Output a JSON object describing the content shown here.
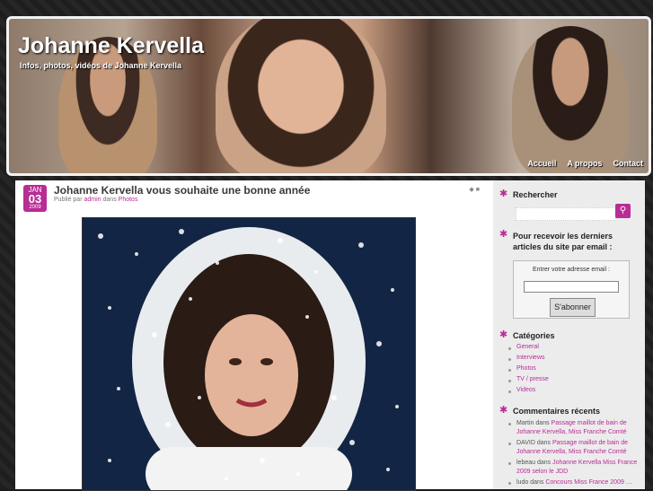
{
  "site": {
    "title": "Johanne Kervella",
    "tagline": "Infos, photos, vidéos de Johanne Kervella",
    "nav": [
      "Accueil",
      "A propos",
      "Contact"
    ]
  },
  "post": {
    "date": {
      "month": "JAN",
      "day": "03",
      "year": "2009"
    },
    "title": "Johanne Kervella vous souhaite une bonne année",
    "meta_prefix": "Publié par",
    "author": "admin",
    "meta_mid": "dans",
    "category": "Photos"
  },
  "sidebar": {
    "search_title": "Rechercher",
    "subscribe_title": "Pour recevoir les derniers articles du site par email :",
    "subscribe_label": "Entrer votre adresse email :",
    "subscribe_button": "S'abonner",
    "categories_title": "Catégories",
    "categories": [
      "General",
      "Interviews",
      "Photos",
      "TV / presse",
      "Videos"
    ],
    "comments_title": "Commentaires récents",
    "comments": [
      {
        "who": "Martin",
        "sep": "dans",
        "link": "Passage maillot de bain de Johanne Kervella, Miss Franche Comté"
      },
      {
        "who": "DAVID",
        "sep": "dans",
        "link": "Passage maillot de bain de Johanne Kervella, Miss Franche Comté"
      },
      {
        "who": "lebeau",
        "sep": "dans",
        "link": "Johanne Kervella Miss France 2009 selon le JDD"
      },
      {
        "who": "ludo",
        "sep": "dans",
        "link": "Concours Miss France 2009 …"
      }
    ]
  },
  "colors": {
    "accent": "#b82c94",
    "sidebar_bg": "#ececec",
    "page_bg": "#1b1b1b"
  }
}
